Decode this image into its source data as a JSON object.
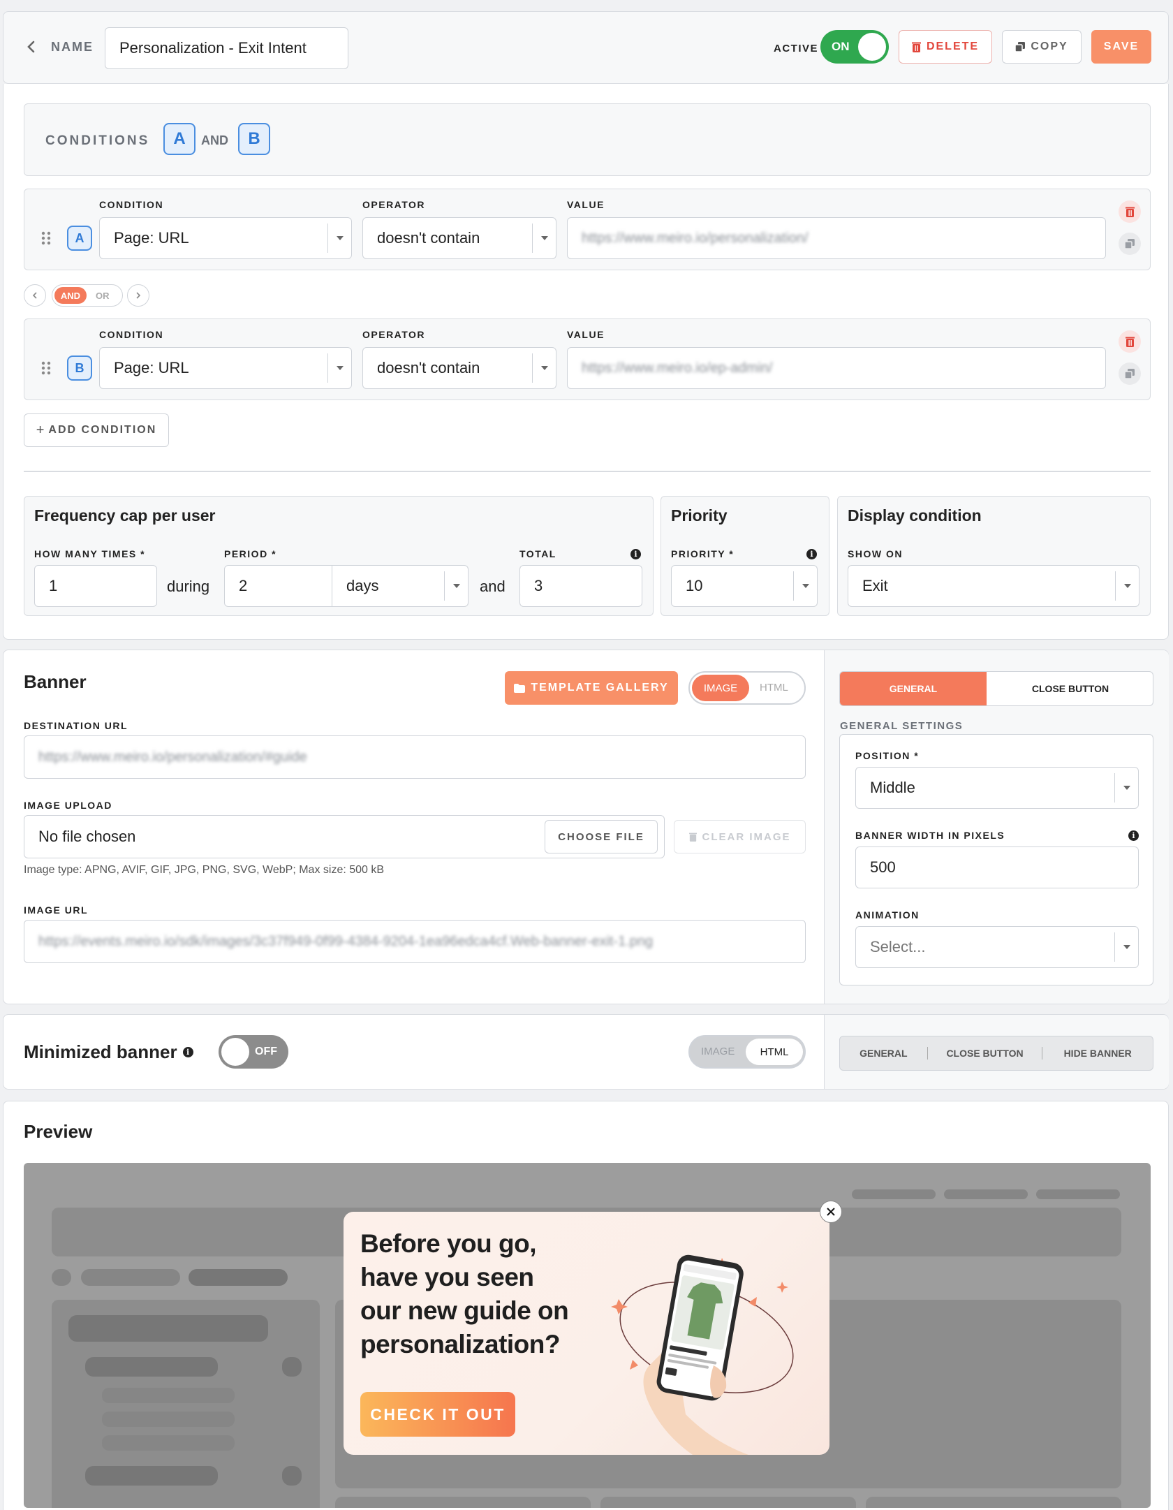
{
  "header": {
    "back_icon": "chevron-left-icon",
    "name_label": "NAME",
    "name_value": "Personalization - Exit Intent",
    "active_label": "ACTIVE",
    "active_toggle": "ON",
    "delete_label": "DELETE",
    "copy_label": "COPY",
    "save_label": "SAVE"
  },
  "conditions": {
    "title": "CONDITIONS",
    "logic": {
      "a": "A",
      "op": "AND",
      "b": "B"
    },
    "column_labels": {
      "condition": "CONDITION",
      "operator": "OPERATOR",
      "value": "VALUE"
    },
    "rows": [
      {
        "letter": "A",
        "condition": "Page: URL",
        "operator": "doesn't contain",
        "value": "https://www.meiro.io/personalization/"
      },
      {
        "letter": "B",
        "condition": "Page: URL",
        "operator": "doesn't contain",
        "value": "https://www.meiro.io/ep-admin/"
      }
    ],
    "joiner": {
      "and": "AND",
      "or": "OR"
    },
    "add_label": "ADD CONDITION"
  },
  "frequency": {
    "title": "Frequency cap per user",
    "how_many_label": "HOW MANY TIMES *",
    "how_many": "1",
    "during": "during",
    "period_label": "PERIOD *",
    "period": "2",
    "period_unit": "days",
    "and": "and",
    "total_label": "TOTAL",
    "total": "3"
  },
  "priority": {
    "title": "Priority",
    "label": "PRIORITY *",
    "value": "10"
  },
  "display": {
    "title": "Display condition",
    "label": "SHOW ON",
    "value": "Exit"
  },
  "banner": {
    "title": "Banner",
    "template_gallery": "TEMPLATE GALLERY",
    "mode_image": "IMAGE",
    "mode_html": "HTML",
    "dest_label": "DESTINATION URL",
    "dest_value": "https://www.meiro.io/personalization/#guide",
    "upload_label": "IMAGE UPLOAD",
    "upload_value": "No file chosen",
    "choose_file": "CHOOSE FILE",
    "clear_image": "CLEAR IMAGE",
    "upload_hint": "Image type: APNG, AVIF, GIF, JPG, PNG, SVG, WebP; Max size: 500 kB",
    "url_label": "IMAGE URL",
    "url_value": "https://events.meiro.io/sdk/images/3c37f949-0f99-4384-9204-1ea96edca4cf.Web-banner-exit-1.png"
  },
  "settings": {
    "tab_general": "GENERAL",
    "tab_close": "CLOSE BUTTON",
    "section_label": "GENERAL SETTINGS",
    "position_label": "POSITION *",
    "position_value": "Middle",
    "width_label": "BANNER WIDTH IN PIXELS",
    "width_value": "500",
    "animation_label": "ANIMATION",
    "animation_placeholder": "Select..."
  },
  "minimized": {
    "title": "Minimized banner",
    "toggle": "OFF",
    "mode_image": "IMAGE",
    "mode_html": "HTML",
    "tab_general": "GENERAL",
    "tab_close": "CLOSE BUTTON",
    "tab_hide": "HIDE BANNER"
  },
  "preview": {
    "title": "Preview",
    "headline_lines": [
      "Before you go,",
      "have you seen",
      "our new guide on",
      "personalization?"
    ],
    "cta": "CHECK IT OUT",
    "close_icon": "close-icon",
    "phone_brand": "Marketplace",
    "phone_product": "Plain t-shirt"
  },
  "colors": {
    "accent": "#f47a5b",
    "green": "#2fa84f",
    "blue": "#2f7ad6",
    "danger": "#e2463b"
  }
}
